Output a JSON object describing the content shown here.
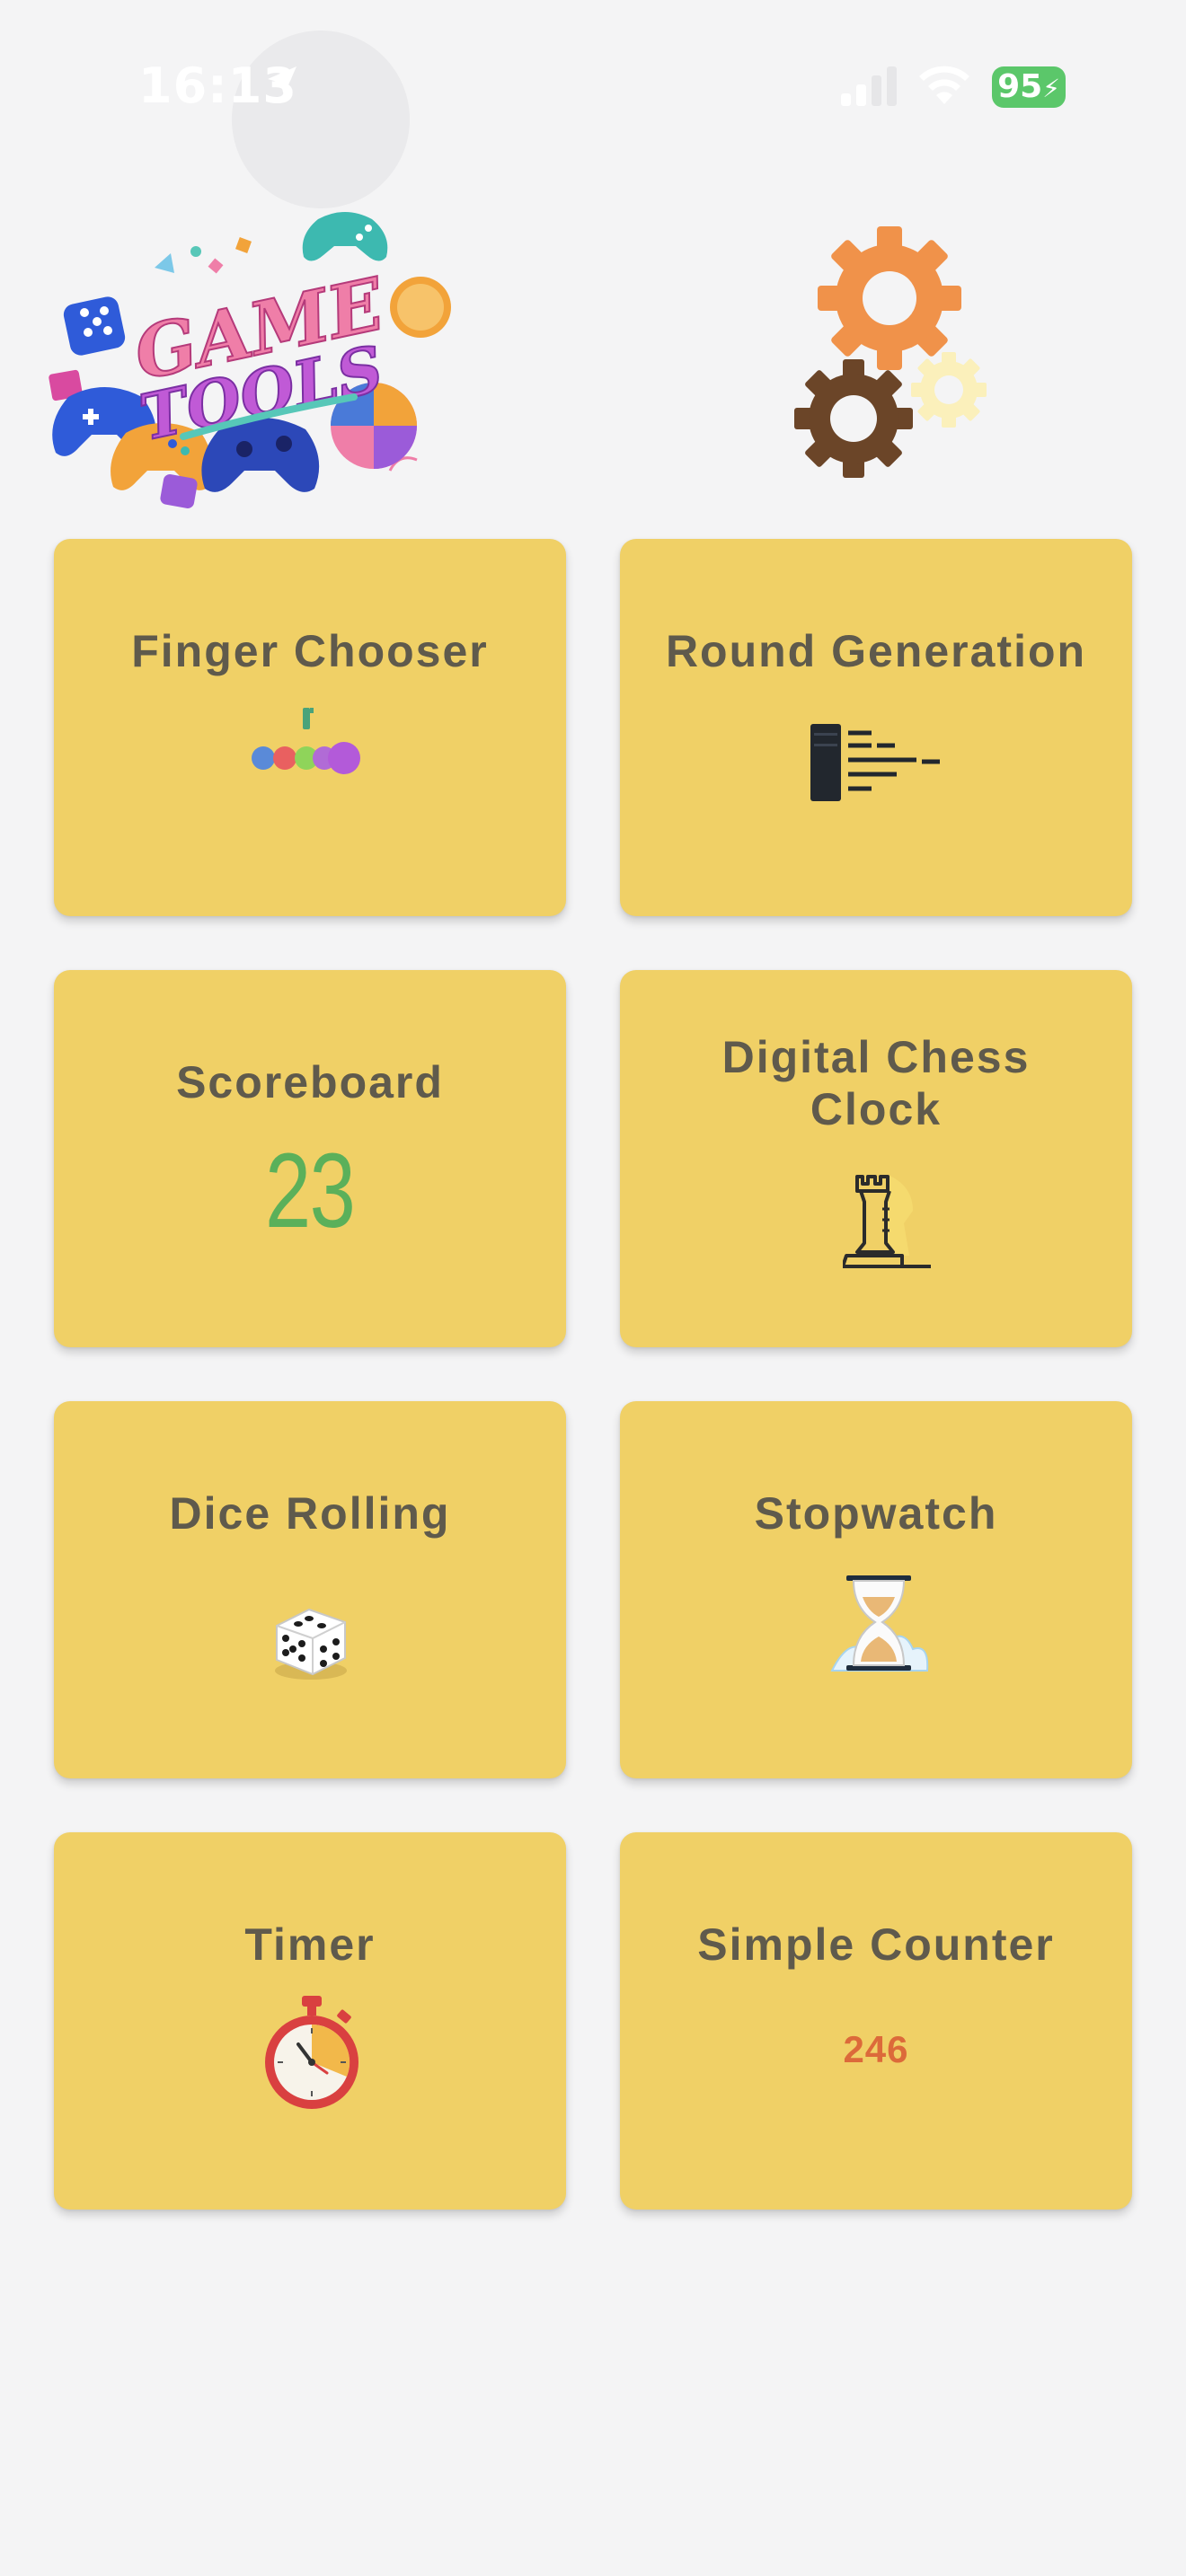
{
  "status_bar": {
    "time": "16:13",
    "battery": "95",
    "icons": [
      "location-arrow-icon",
      "cellular-signal-icon",
      "wifi-icon",
      "battery-charging-icon"
    ]
  },
  "header": {
    "logo_text_line1": "GAME",
    "logo_text_line2": "TOOLS",
    "settings_icon": "gears-icon"
  },
  "tools": [
    {
      "title": "Finger Chooser",
      "icon": "finger-chooser-icon"
    },
    {
      "title": "Round Generation",
      "icon": "round-generation-icon"
    },
    {
      "title": "Scoreboard",
      "icon": "scoreboard-icon",
      "icon_text": "23"
    },
    {
      "title": "Digital Chess Clock",
      "title_line1": "Digital Chess",
      "title_line2": "Clock",
      "icon": "chess-rook-icon"
    },
    {
      "title": "Dice Rolling",
      "icon": "dice-icon"
    },
    {
      "title": "Stopwatch",
      "icon": "hourglass-icon"
    },
    {
      "title": "Timer",
      "icon": "stopwatch-timer-icon"
    },
    {
      "title": "Simple Counter",
      "icon": "counter-icon",
      "icon_text": "246"
    }
  ],
  "colors": {
    "background": "#f4f4f5",
    "card": "#f0d066",
    "card_title": "#5f5a4c",
    "scoreboard_number": "#5bb05a",
    "counter_number": "#dc6a3a",
    "battery": "#5bc76a",
    "gear_orange": "#f0924a",
    "gear_brown": "#6b4528",
    "gear_cream": "#fbf0bb"
  }
}
